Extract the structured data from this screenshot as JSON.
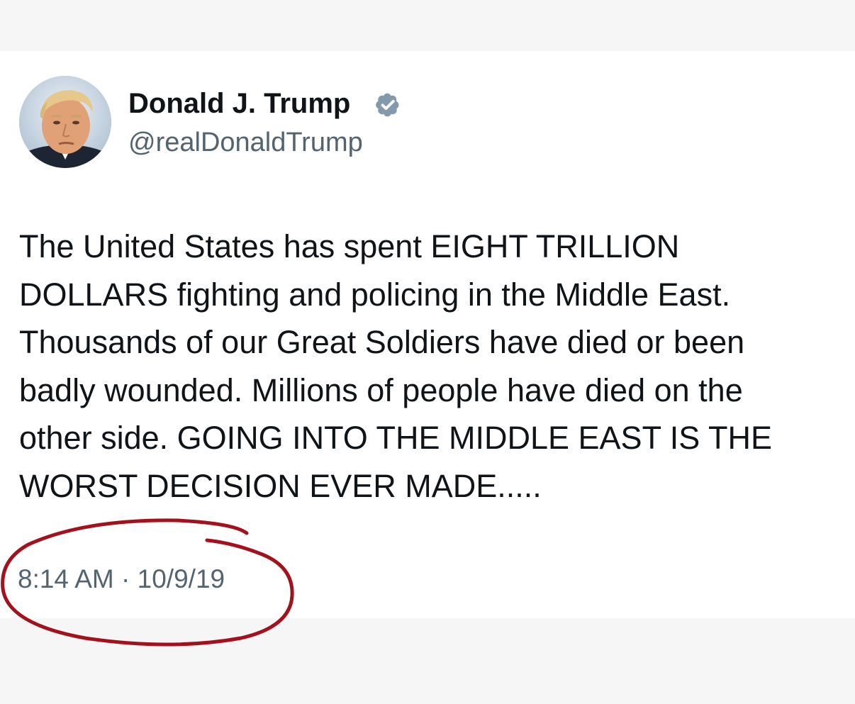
{
  "tweet": {
    "author": {
      "display_name": "Donald J. Trump",
      "handle": "@realDonaldTrump",
      "verified": true,
      "badge_color": "#829aab"
    },
    "text_lines": [
      "The United States has spent EIGHT TRILLION",
      "DOLLARS fighting and policing in the Middle East.",
      "Thousands of our Great Soldiers have died or been",
      "badly wounded. Millions of people have died on the",
      "other side. GOING INTO THE MIDDLE EAST IS THE",
      "WORST DECISION EVER MADE....."
    ],
    "timestamp": {
      "time": "8:14 AM",
      "separator": "·",
      "date": "10/9/19"
    }
  },
  "annotation": {
    "shape": "hand-drawn circle around timestamp",
    "color": "#a3121c"
  },
  "colors": {
    "background": "#f6f6f6",
    "card": "#ffffff",
    "text_primary": "#0f1419",
    "text_secondary": "#536471"
  }
}
